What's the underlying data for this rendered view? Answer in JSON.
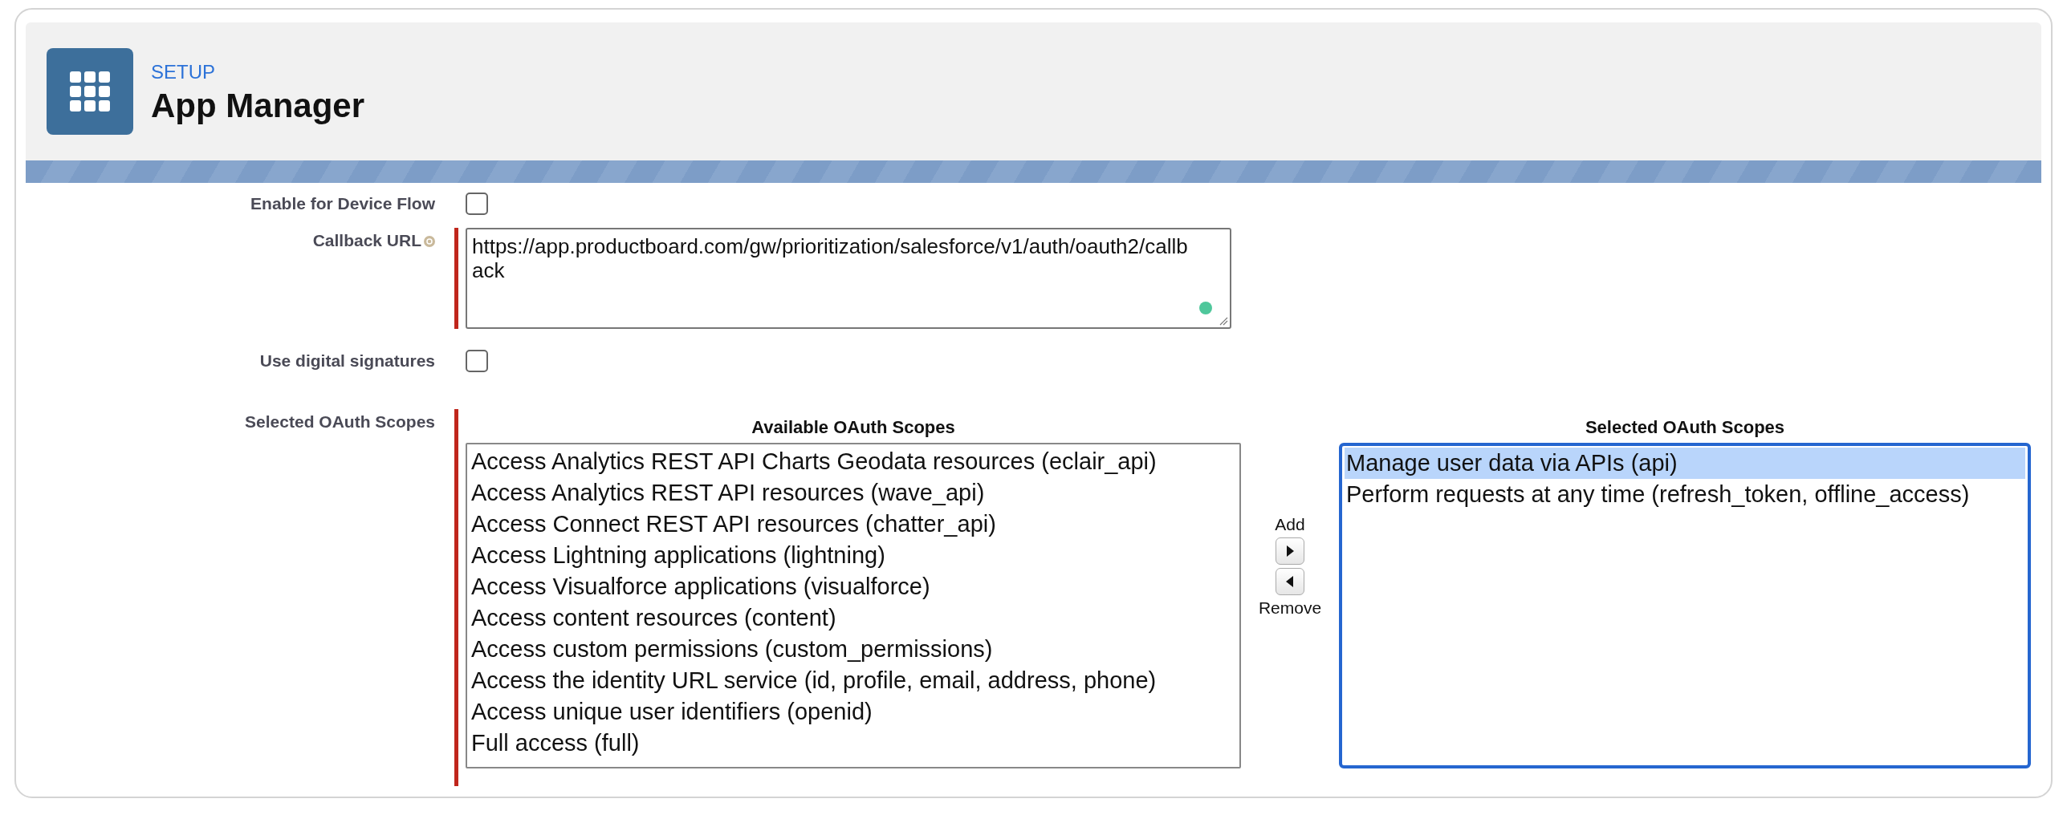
{
  "header": {
    "breadcrumb": "SETUP",
    "title": "App Manager"
  },
  "fields": [
    {
      "kind": "checkbox",
      "label": "Enable for Device Flow",
      "checked": false
    },
    {
      "kind": "textarea",
      "label": "Callback URL",
      "required": true,
      "help": true,
      "value": "https://app.productboard.com/gw/prioritization/salesforce/v1/auth/oauth2/callback"
    },
    {
      "kind": "checkbox",
      "label": "Use digital signatures",
      "checked": false
    }
  ],
  "scopes": {
    "label": "Selected OAuth Scopes",
    "required": true,
    "available": {
      "heading": "Available OAuth Scopes",
      "items": [
        {
          "label": "Access Analytics REST API Charts Geodata resources (eclair_api)",
          "selected": false
        },
        {
          "label": "Access Analytics REST API resources (wave_api)",
          "selected": false
        },
        {
          "label": "Access Connect REST API resources (chatter_api)",
          "selected": false
        },
        {
          "label": "Access Lightning applications (lightning)",
          "selected": false
        },
        {
          "label": "Access Visualforce applications (visualforce)",
          "selected": false
        },
        {
          "label": "Access content resources (content)",
          "selected": false
        },
        {
          "label": "Access custom permissions (custom_permissions)",
          "selected": false
        },
        {
          "label": "Access the identity URL service (id, profile, email, address, phone)",
          "selected": false
        },
        {
          "label": "Access unique user identifiers (openid)",
          "selected": false
        },
        {
          "label": "Full access (full)",
          "selected": false
        }
      ]
    },
    "add_label": "Add",
    "remove_label": "Remove",
    "chosen": {
      "heading": "Selected OAuth Scopes",
      "focused": true,
      "items": [
        {
          "label": "Manage user data via APIs (api)",
          "selected": true
        },
        {
          "label": "Perform requests at any time (refresh_token, offline_access)",
          "selected": false
        }
      ]
    }
  }
}
